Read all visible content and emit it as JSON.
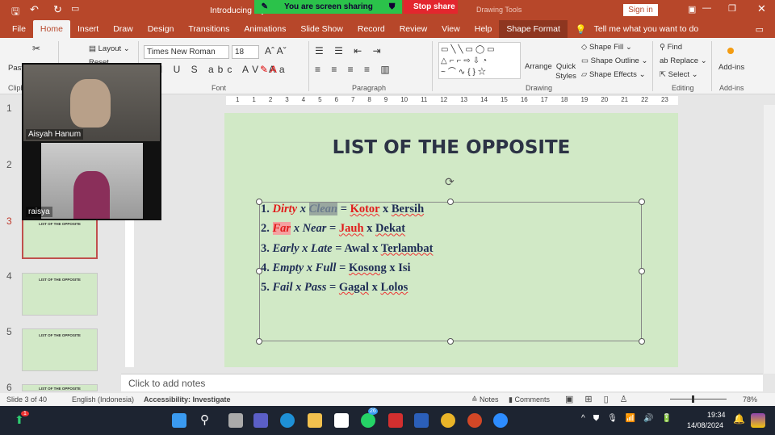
{
  "title_bar": {
    "document_title": "Introducing My...",
    "sign_in": "Sign in",
    "context_tab": "Drawing Tools"
  },
  "sharing": {
    "status": "You are screen sharing",
    "stop": "Stop share"
  },
  "tabs": [
    "File",
    "Home",
    "Insert",
    "Draw",
    "Design",
    "Transitions",
    "Animations",
    "Slide Show",
    "Record",
    "Review",
    "View",
    "Help",
    "Shape Format"
  ],
  "tell_me": "Tell me what you want to do",
  "ribbon": {
    "paste": "Paste",
    "clipboard": "Clipboard",
    "layout": "Layout",
    "reset": "Reset",
    "font_name": "Times New Roman",
    "font_size": "18",
    "font": "Font",
    "paragraph": "Paragraph",
    "arrange": "Arrange",
    "quick_styles": "Quick Styles",
    "shape_fill": "Shape Fill",
    "shape_outline": "Shape Outline",
    "shape_effects": "Shape Effects",
    "drawing": "Drawing",
    "find": "Find",
    "replace": "Replace",
    "select": "Select",
    "editing": "Editing",
    "addins": "Add-ins",
    "addins_group": "Add-ins"
  },
  "ruler": [
    "1",
    "1",
    "2",
    "3",
    "4",
    "5",
    "6",
    "7",
    "8",
    "9",
    "10",
    "11",
    "12",
    "13",
    "14",
    "15",
    "16",
    "17",
    "18",
    "19",
    "20",
    "21",
    "22",
    "23"
  ],
  "video": {
    "p1": "Aisyah Hanum",
    "p2": "raisya"
  },
  "thumbnails": [
    {
      "num": "1"
    },
    {
      "num": "2"
    },
    {
      "num": "3",
      "title": "LIST OF THE OPPOSITE"
    },
    {
      "num": "4",
      "title": "LIST OF THE OPPOSITE"
    },
    {
      "num": "5",
      "title": "LIST OF THE OPPOSITE"
    },
    {
      "num": "6",
      "title": "LIST OF THE OPPOSITE"
    }
  ],
  "slide": {
    "title": "LIST OF THE OPPOSITE",
    "lines": [
      {
        "n": "1.",
        "a": "Dirty",
        "b": "Clean",
        "c": "Kotor",
        "d": "Bersih"
      },
      {
        "n": "2.",
        "a": "Far",
        "b": "Near",
        "c": "Jauh",
        "d": "Dekat"
      },
      {
        "n": "3.",
        "a": "Early",
        "b": "Late",
        "c": "Awal",
        "d": "Terlambat"
      },
      {
        "n": "4.",
        "a": "Empty",
        "b": "Full",
        "c": "Kosong",
        "d": "Isi"
      },
      {
        "n": "5.",
        "a": "Fail",
        "b": "Pass",
        "c": "Gagal",
        "d": "Lolos"
      }
    ],
    "x": " x ",
    "eq": " = "
  },
  "notes_placeholder": "Click to add notes",
  "status": {
    "slide": "Slide 3 of 40",
    "language": "English (Indonesia)",
    "accessibility": "Accessibility: Investigate",
    "notes": "Notes",
    "comments": "Comments",
    "zoom": "78%"
  },
  "taskbar": {
    "time": "19:34",
    "date": "14/08/2024",
    "whatsapp_badge": "26",
    "notif_badge": "1"
  }
}
